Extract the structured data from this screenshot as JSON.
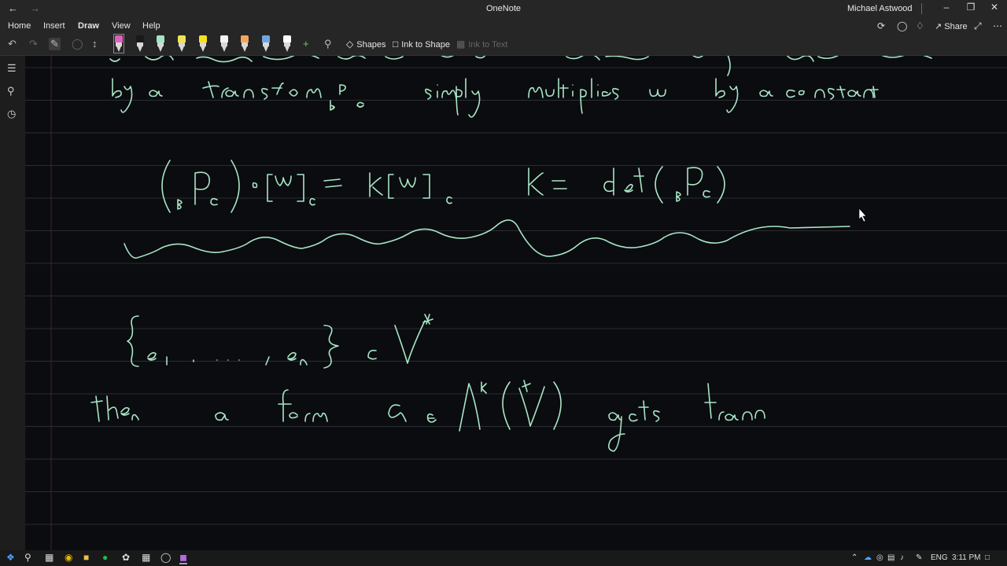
{
  "window": {
    "title": "OneNote",
    "user": "Michael Astwood",
    "back_icon": "arrow-left-icon",
    "forward_icon": "arrow-right-icon"
  },
  "menu": {
    "items": [
      {
        "label": "Home"
      },
      {
        "label": "Insert"
      },
      {
        "label": "Draw"
      },
      {
        "label": "View"
      },
      {
        "label": "Help"
      }
    ],
    "active": "Draw",
    "share_label": "Share"
  },
  "toolbar": {
    "shapes_label": "Shapes",
    "ink_to_shape_label": "Ink to Shape",
    "ink_to_text_label": "Ink to Text",
    "pens": [
      {
        "name": "pen-black-pink",
        "color": "#e060c0"
      },
      {
        "name": "pen-black",
        "color": "#1a1a1a"
      },
      {
        "name": "pen-mint",
        "color": "#9ee6c4"
      },
      {
        "name": "highlighter-yellow",
        "color": "#f2e34c"
      },
      {
        "name": "highlighter-yellow-wide",
        "color": "#f7e11d"
      },
      {
        "name": "pen-white",
        "color": "#f4f4f4"
      },
      {
        "name": "pen-orange",
        "color": "#f2a65a"
      },
      {
        "name": "pen-blue",
        "color": "#6fa8dc"
      },
      {
        "name": "pen-white-2",
        "color": "#ffffff"
      }
    ]
  },
  "ink": {
    "stroke_color": "#a8e6c6",
    "rule_color": "#2a2d33",
    "margin_color": "#4a1f22"
  },
  "taskbar": {
    "time": "3:11 PM",
    "language": "ENG"
  }
}
